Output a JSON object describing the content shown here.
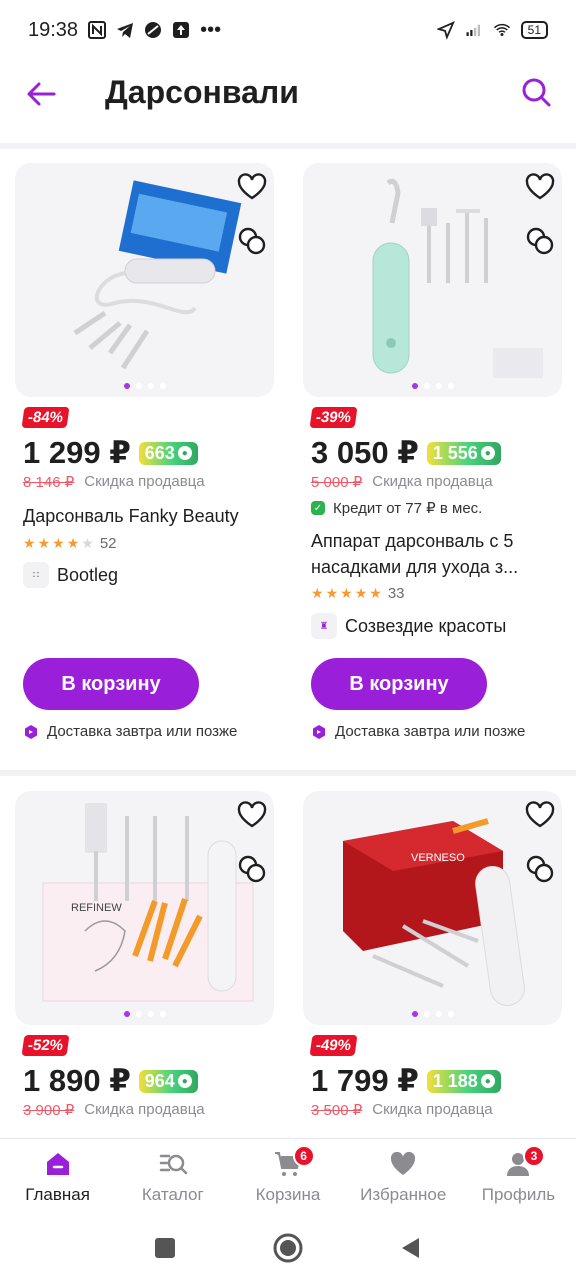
{
  "status_bar": {
    "time": "19:38",
    "battery": "51"
  },
  "header": {
    "title": "Дарсонвали"
  },
  "products": [
    {
      "discount": "-84%",
      "price": "1 299 ₽",
      "bonus": "663",
      "old_price": "8 146 ₽",
      "old_label": "Скидка продавца",
      "title": "Дарсонваль Fanky Beauty",
      "rating_count": "52",
      "seller": "Bootleg",
      "cart_label": "В корзину",
      "delivery": "Доставка завтра или позже"
    },
    {
      "discount": "-39%",
      "price": "3 050 ₽",
      "bonus": "1 556",
      "old_price": "5 000 ₽",
      "old_label": "Скидка продавца",
      "credit": "Кредит от 77 ₽ в мес.",
      "title_line1": "Аппарат дарсонваль с 5",
      "title_line2": "насадками для ухода з...",
      "rating_count": "33",
      "seller": "Созвездие красоты",
      "cart_label": "В корзину",
      "delivery": "Доставка завтра или позже"
    },
    {
      "discount": "-52%",
      "price": "1 890 ₽",
      "bonus": "964",
      "old_price": "3 900 ₽",
      "old_label": "Скидка продавца",
      "image_brand": "REFINEW"
    },
    {
      "discount": "-49%",
      "price": "1 799 ₽",
      "bonus": "1 188",
      "old_price": "3 500 ₽",
      "old_label": "Скидка продавца",
      "image_brand": "VERNESO"
    }
  ],
  "bottom_nav": [
    {
      "label": "Главная",
      "icon": "home-icon"
    },
    {
      "label": "Каталог",
      "icon": "catalog-icon"
    },
    {
      "label": "Корзина",
      "icon": "cart-icon",
      "badge": "6"
    },
    {
      "label": "Избранное",
      "icon": "heart-icon"
    },
    {
      "label": "Профиль",
      "icon": "profile-icon",
      "badge": "3"
    }
  ],
  "colors": {
    "accent": "#9a1fd9",
    "discount": "#e8132a",
    "bonus_green": "#49d37d",
    "star": "#f79b2e"
  }
}
